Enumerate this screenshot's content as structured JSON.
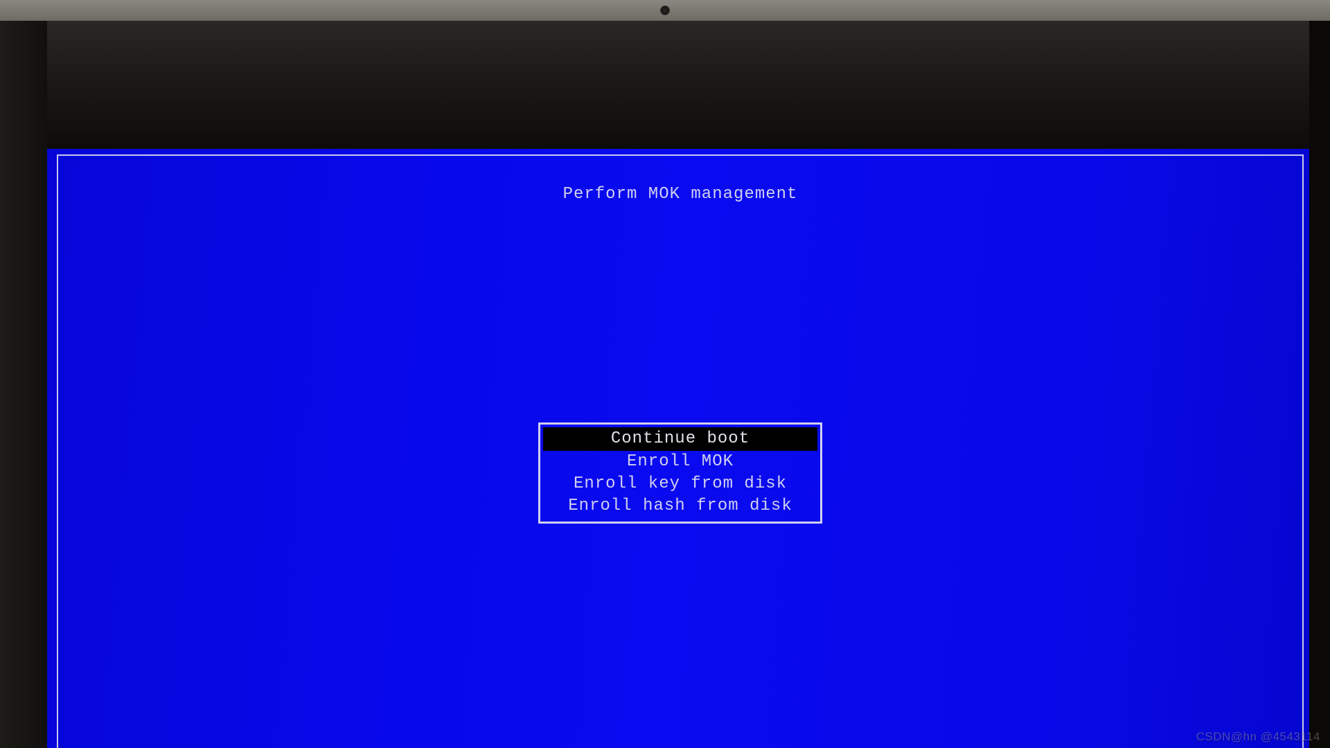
{
  "screen": {
    "title": "Perform MOK management"
  },
  "menu": {
    "items": [
      {
        "label": "Continue boot",
        "selected": true
      },
      {
        "label": "Enroll MOK",
        "selected": false
      },
      {
        "label": "Enroll key from disk",
        "selected": false
      },
      {
        "label": "Enroll hash from disk",
        "selected": false
      }
    ]
  },
  "watermark": {
    "text": "CSDN@hn @4543114"
  }
}
